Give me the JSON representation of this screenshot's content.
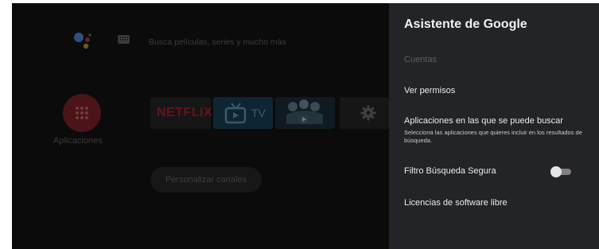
{
  "home": {
    "search_placeholder": "Busca películas, series y mucho más",
    "apps_label": "Aplicaciones",
    "tiles": {
      "netflix": "NETFLIX",
      "tv": "TV"
    },
    "channels_button": "Personalizar canales"
  },
  "panel": {
    "title": "Asistente de Google",
    "section": "Cuentas",
    "items": [
      {
        "label": "Ver permisos"
      },
      {
        "label": "Aplicaciones en las que se puede buscar",
        "description": "Selecciona las aplicaciones que quieres incluir en los resultados de búsqueda."
      },
      {
        "label": "Filtro Búsqueda Segura",
        "toggle_on": false
      },
      {
        "label": "Licencias de software libre"
      }
    ]
  },
  "colors": {
    "panel_bg": "#232427",
    "overlay": "#0b0b0b"
  }
}
